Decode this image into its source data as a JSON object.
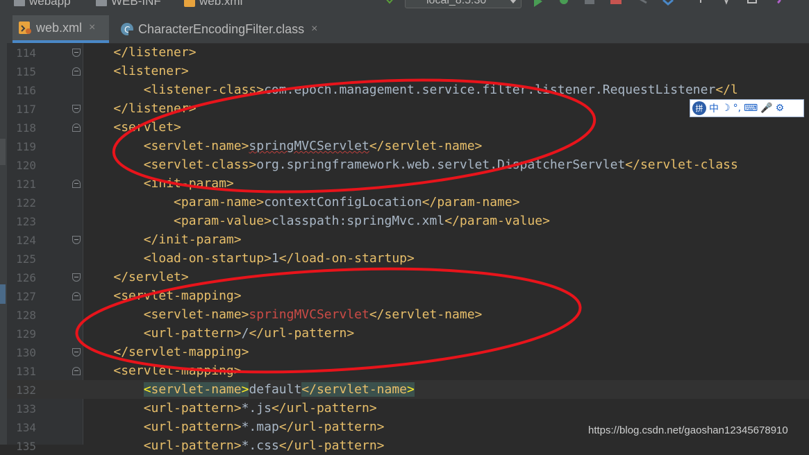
{
  "breadcrumbs": [
    "webapp",
    "WEB-INF",
    "web.xml"
  ],
  "run_config": {
    "label": "local_8.5.30"
  },
  "tabs": [
    {
      "label": "web.xml",
      "close": "×",
      "active": true
    },
    {
      "label": "CharacterEncodingFilter.class",
      "close": "×",
      "active": false
    }
  ],
  "editor": {
    "lines": [
      {
        "n": "114",
        "parts": [
          [
            "    ",
            "txt"
          ],
          [
            "</listener>",
            "tag"
          ]
        ]
      },
      {
        "n": "115",
        "parts": [
          [
            "    ",
            "txt"
          ],
          [
            "<listener>",
            "tag"
          ]
        ]
      },
      {
        "n": "116",
        "parts": [
          [
            "        ",
            "txt"
          ],
          [
            "<listener-class>",
            "tag"
          ],
          [
            "com.epoch.management.service.filter.listener.RequestListener",
            "txt"
          ],
          [
            "</l",
            "tag"
          ]
        ]
      },
      {
        "n": "117",
        "parts": [
          [
            "    ",
            "txt"
          ],
          [
            "</listener>",
            "tag"
          ]
        ]
      },
      {
        "n": "118",
        "parts": [
          [
            "    ",
            "txt"
          ],
          [
            "<servlet>",
            "tag"
          ]
        ]
      },
      {
        "n": "119",
        "parts": [
          [
            "        ",
            "txt"
          ],
          [
            "<servlet-name>",
            "tag"
          ],
          [
            "springMVCServlet",
            "err"
          ],
          [
            "</servlet-name>",
            "tag"
          ]
        ]
      },
      {
        "n": "120",
        "parts": [
          [
            "        ",
            "txt"
          ],
          [
            "<servlet-class>",
            "tag"
          ],
          [
            "org.springframework.web.servlet.DispatcherServlet",
            "txt"
          ],
          [
            "</servlet-class",
            "tag"
          ]
        ]
      },
      {
        "n": "121",
        "parts": [
          [
            "        ",
            "txt"
          ],
          [
            "<init-param>",
            "tag"
          ]
        ]
      },
      {
        "n": "122",
        "parts": [
          [
            "            ",
            "txt"
          ],
          [
            "<param-name>",
            "tag"
          ],
          [
            "contextConfigLocation",
            "txt"
          ],
          [
            "</param-name>",
            "tag"
          ]
        ]
      },
      {
        "n": "123",
        "parts": [
          [
            "            ",
            "txt"
          ],
          [
            "<param-value>",
            "tag"
          ],
          [
            "classpath:springMvc.xml",
            "txt"
          ],
          [
            "</param-value>",
            "tag"
          ]
        ]
      },
      {
        "n": "124",
        "parts": [
          [
            "        ",
            "txt"
          ],
          [
            "</init-param>",
            "tag"
          ]
        ]
      },
      {
        "n": "125",
        "parts": [
          [
            "        ",
            "txt"
          ],
          [
            "<load-on-startup>",
            "tag"
          ],
          [
            "1",
            "txt"
          ],
          [
            "</load-on-startup>",
            "tag"
          ]
        ]
      },
      {
        "n": "126",
        "parts": [
          [
            "    ",
            "txt"
          ],
          [
            "</servlet>",
            "tag"
          ]
        ]
      },
      {
        "n": "127",
        "parts": [
          [
            "    ",
            "txt"
          ],
          [
            "<servlet-mapping>",
            "tag"
          ]
        ]
      },
      {
        "n": "128",
        "parts": [
          [
            "        ",
            "txt"
          ],
          [
            "<servlet-name>",
            "tag"
          ],
          [
            "springMVCServlet",
            "red"
          ],
          [
            "</servlet-name>",
            "tag"
          ]
        ]
      },
      {
        "n": "129",
        "parts": [
          [
            "        ",
            "txt"
          ],
          [
            "<url-pattern>",
            "tag"
          ],
          [
            "/",
            "txt"
          ],
          [
            "</url-pattern>",
            "tag"
          ]
        ]
      },
      {
        "n": "130",
        "parts": [
          [
            "    ",
            "txt"
          ],
          [
            "</servlet-mapping>",
            "tag"
          ]
        ]
      },
      {
        "n": "131",
        "parts": [
          [
            "    ",
            "txt"
          ],
          [
            "<servlet-mapping>",
            "tag"
          ]
        ]
      },
      {
        "n": "132",
        "parts": [
          [
            "        ",
            "txt"
          ],
          [
            "<",
            "hl"
          ],
          [
            "servlet-name",
            "tag hlt"
          ],
          [
            ">",
            "hl"
          ],
          [
            "default",
            "txt"
          ],
          [
            "</servlet-name",
            "tag hlt"
          ],
          [
            ">",
            "hl"
          ]
        ],
        "current": true
      },
      {
        "n": "133",
        "parts": [
          [
            "        ",
            "txt"
          ],
          [
            "<url-pattern>",
            "tag"
          ],
          [
            "*.js",
            "txt"
          ],
          [
            "</url-pattern>",
            "tag"
          ]
        ]
      },
      {
        "n": "134",
        "parts": [
          [
            "        ",
            "txt"
          ],
          [
            "<url-pattern>",
            "tag"
          ],
          [
            "*.map",
            "txt"
          ],
          [
            "</url-pattern>",
            "tag"
          ]
        ]
      },
      {
        "n": "135",
        "parts": [
          [
            "        ",
            "txt"
          ],
          [
            "<url-pattern>",
            "tag"
          ],
          [
            "*.css",
            "txt"
          ],
          [
            "</url-pattern>",
            "tag"
          ]
        ]
      }
    ]
  },
  "ime": {
    "logo": "拼",
    "chinese": "中",
    "moon": "☽",
    "punct": "°,",
    "keyboard": "⌨",
    "mic": "🎤",
    "gear": "⚙"
  },
  "watermark": "https://blog.csdn.net/gaoshan12345678910",
  "colors": {
    "background": "#2b2b2b",
    "tag": "#e8bf6a",
    "text": "#a9b7c6",
    "annotation": "#e8141b"
  }
}
